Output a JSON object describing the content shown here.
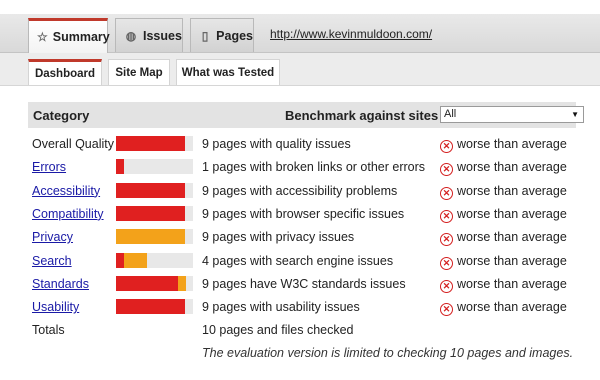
{
  "tabs": [
    {
      "label": "Summary",
      "icon": "star-icon",
      "active": true
    },
    {
      "label": "Issues",
      "icon": "globe-icon",
      "active": false
    },
    {
      "label": "Pages",
      "icon": "document-icon",
      "active": false
    }
  ],
  "url": "http://www.kevinmuldoon.com/",
  "subtabs": [
    {
      "label": "Dashboard",
      "active": true
    },
    {
      "label": "Site Map",
      "active": false
    },
    {
      "label": "What was Tested",
      "active": false
    }
  ],
  "table": {
    "category_header": "Category",
    "benchmark_label": "Benchmark against sites",
    "benchmark_value": "All",
    "rows": [
      {
        "category": "Overall Quality",
        "link": false,
        "red": 0.9,
        "orange": 0,
        "description": "9 pages with quality issues",
        "comparison": "worse than average"
      },
      {
        "category": "Errors",
        "link": true,
        "red": 0.1,
        "orange": 0,
        "description": "1 pages with broken links or other errors",
        "comparison": "worse than average"
      },
      {
        "category": "Accessibility",
        "link": true,
        "red": 0.9,
        "orange": 0,
        "description": "9 pages with accessibility problems",
        "comparison": "worse than average"
      },
      {
        "category": "Compatibility",
        "link": true,
        "red": 0.9,
        "orange": 0,
        "description": "9 pages with browser specific issues",
        "comparison": "worse than average"
      },
      {
        "category": "Privacy",
        "link": true,
        "red": 0,
        "orange": 0.9,
        "description": "9 pages with privacy issues",
        "comparison": "worse than average"
      },
      {
        "category": "Search",
        "link": true,
        "red": 0.1,
        "orange": 0.3,
        "description": "4 pages with search engine issues",
        "comparison": "worse than average"
      },
      {
        "category": "Standards",
        "link": true,
        "red": 0.8,
        "orange": 0.1,
        "description": "9 pages have W3C standards issues",
        "comparison": "worse than average"
      },
      {
        "category": "Usability",
        "link": true,
        "red": 0.9,
        "orange": 0,
        "description": "9 pages with usability issues",
        "comparison": "worse than average"
      }
    ],
    "totals_label": "Totals",
    "totals_description": "10 pages and files checked"
  },
  "note": "The evaluation version is limited to checking 10 pages and images.",
  "colors": {
    "red": "#e02020",
    "orange": "#f3a21a",
    "accent": "#c0392b"
  }
}
